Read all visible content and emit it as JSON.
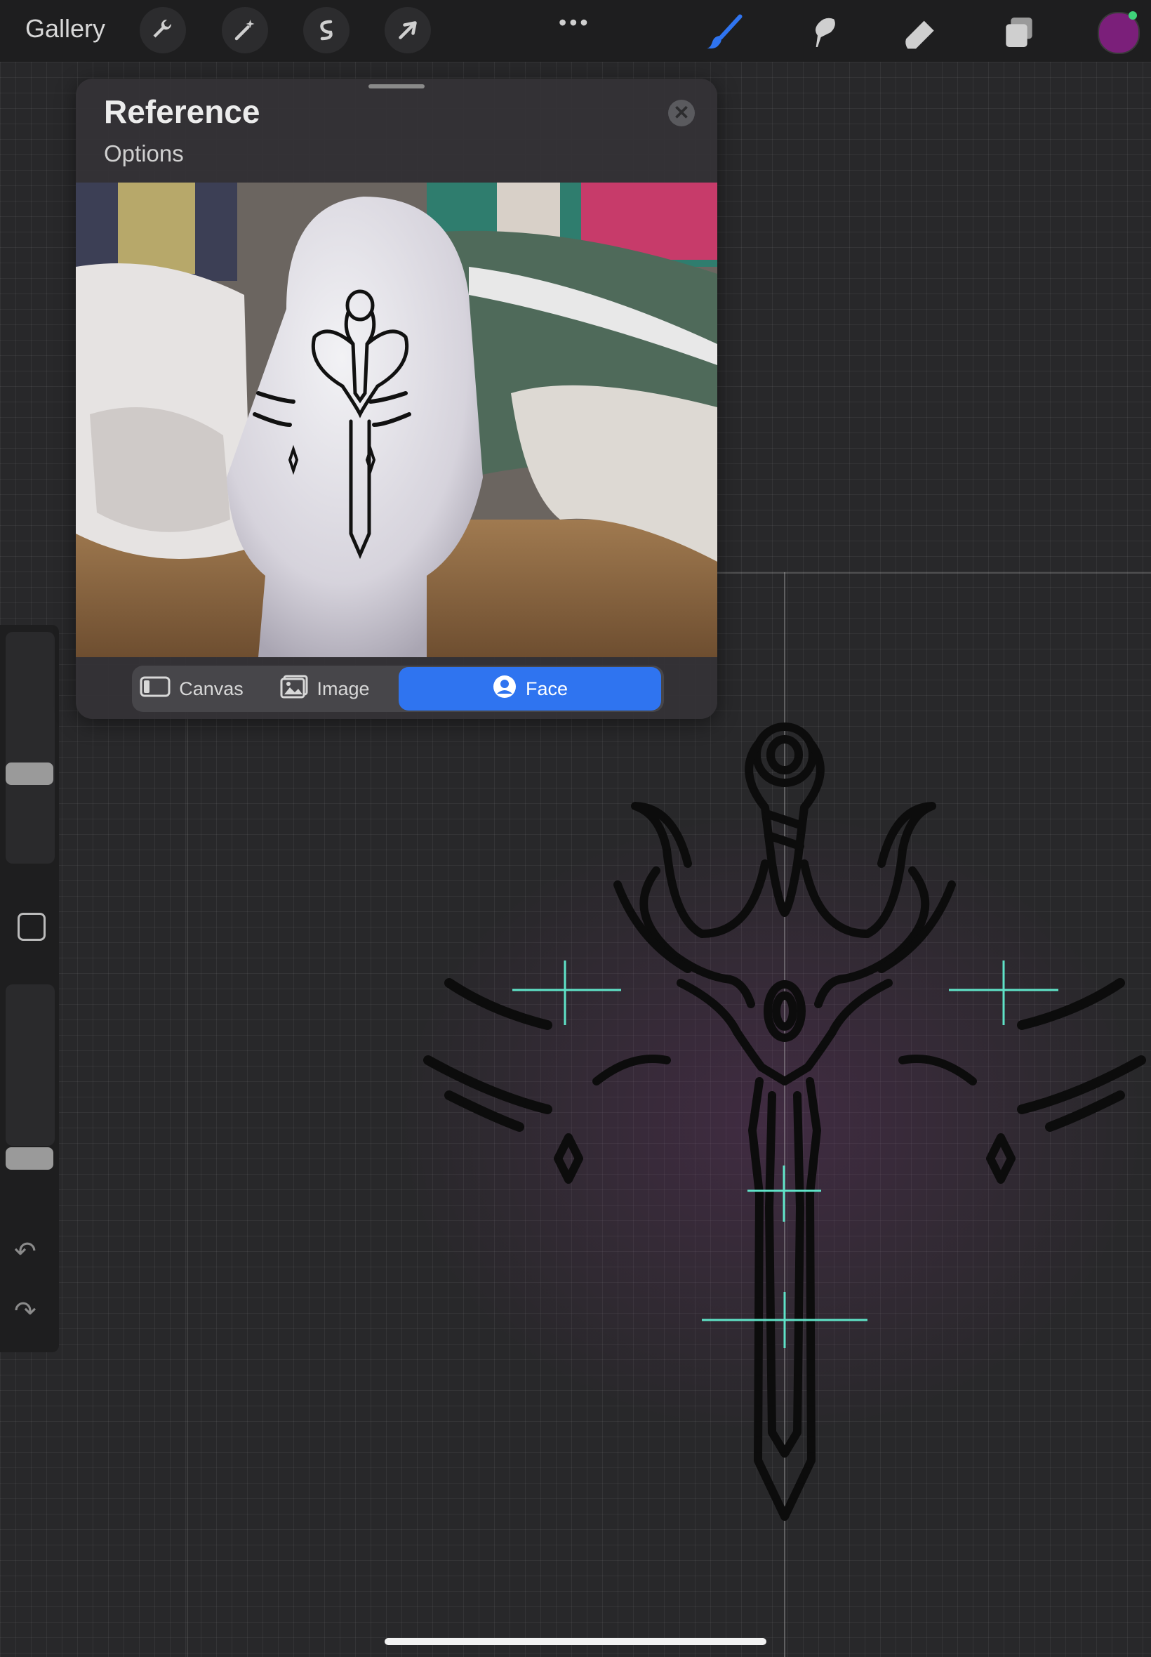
{
  "topbar": {
    "gallery_label": "Gallery",
    "left_tools": [
      "wrench-icon",
      "magic-wand-icon",
      "selection-icon",
      "transform-arrow-icon"
    ],
    "more_label": "•••",
    "right_tools": [
      "brush-icon",
      "smudge-icon",
      "eraser-icon",
      "layers-icon"
    ],
    "color_hex": "#7b1f7a",
    "accent_hex": "#2f74f0"
  },
  "reference": {
    "title": "Reference",
    "options_label": "Options",
    "close_glyph": "✕",
    "tabs": [
      {
        "label": "Canvas",
        "icon": "canvas-icon",
        "active": false
      },
      {
        "label": "Image",
        "icon": "image-icon",
        "active": false
      },
      {
        "label": "Face",
        "icon": "face-icon",
        "active": true
      }
    ]
  },
  "sidebar": {
    "brush_size_level": 0.62,
    "opacity_level": 0.18,
    "undo_glyph": "↶",
    "redo_glyph": "↷"
  }
}
